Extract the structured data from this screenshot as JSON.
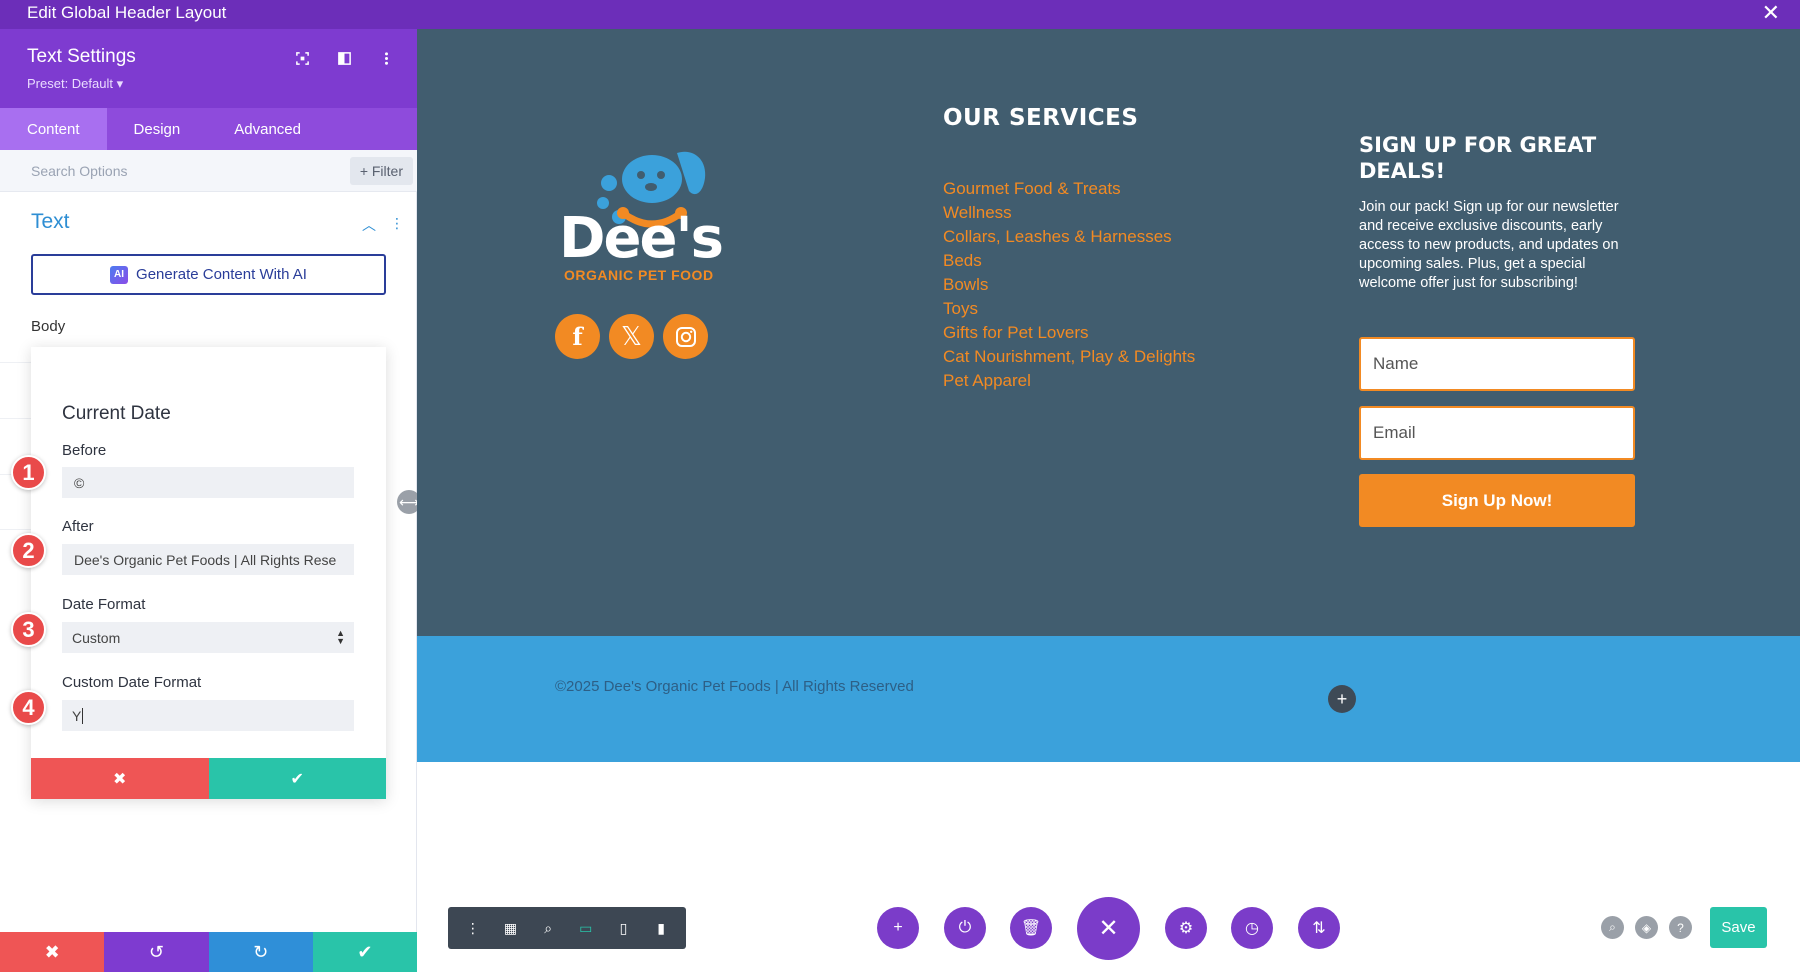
{
  "window": {
    "title": "Edit Global Header Layout"
  },
  "panel": {
    "title": "Text Settings",
    "preset": "Preset: Default ▾",
    "tabs": [
      {
        "label": "Content",
        "active": true
      },
      {
        "label": "Design",
        "active": false
      },
      {
        "label": "Advanced",
        "active": false
      }
    ],
    "search": {
      "placeholder": "Search Options"
    },
    "filter_label": "+ Filter",
    "section_title": "Text",
    "ai_button": "Generate Content With AI",
    "ai_badge": "AI",
    "body_label": "Body"
  },
  "popup": {
    "title": "Current Date",
    "before_label": "Before",
    "before_value": "©",
    "after_label": "After",
    "after_value": "Dee's Organic Pet Foods | All Rights Rese",
    "date_format_label": "Date Format",
    "date_format_value": "Custom",
    "custom_format_label": "Custom Date Format",
    "custom_format_value": "Y"
  },
  "annotations": [
    "1",
    "2",
    "3",
    "4"
  ],
  "preview": {
    "brand_name": "Dee's",
    "brand_sub": "ORGANIC PET FOOD",
    "services_title": "OUR SERVICES",
    "services": [
      "Gourmet Food & Treats",
      "Wellness",
      "Collars, Leashes & Harnesses",
      "Beds",
      "Bowls",
      "Toys",
      "Gifts for Pet Lovers",
      "Cat Nourishment, Play & Delights",
      "Pet Apparel"
    ],
    "signup_title": "SIGN UP FOR GREAT DEALS!",
    "signup_text": "Join our pack! Sign up for our newsletter and receive exclusive discounts, early access to new products, and updates on upcoming sales. Plus, get a special welcome offer just for subscribing!",
    "name_placeholder": "Name",
    "email_placeholder": "Email",
    "signup_button": "Sign Up Now!",
    "copyright": "©2025 Dee's Organic Pet Foods | All Rights Reserved"
  },
  "footer": {
    "save_label": "Save"
  },
  "colors": {
    "purple": "#6c2eb9",
    "accent_orange": "#f28a23",
    "dark_section": "#415d6f",
    "blue_section": "#3ba1db",
    "teal": "#29c4a9",
    "red": "#ef5555"
  }
}
